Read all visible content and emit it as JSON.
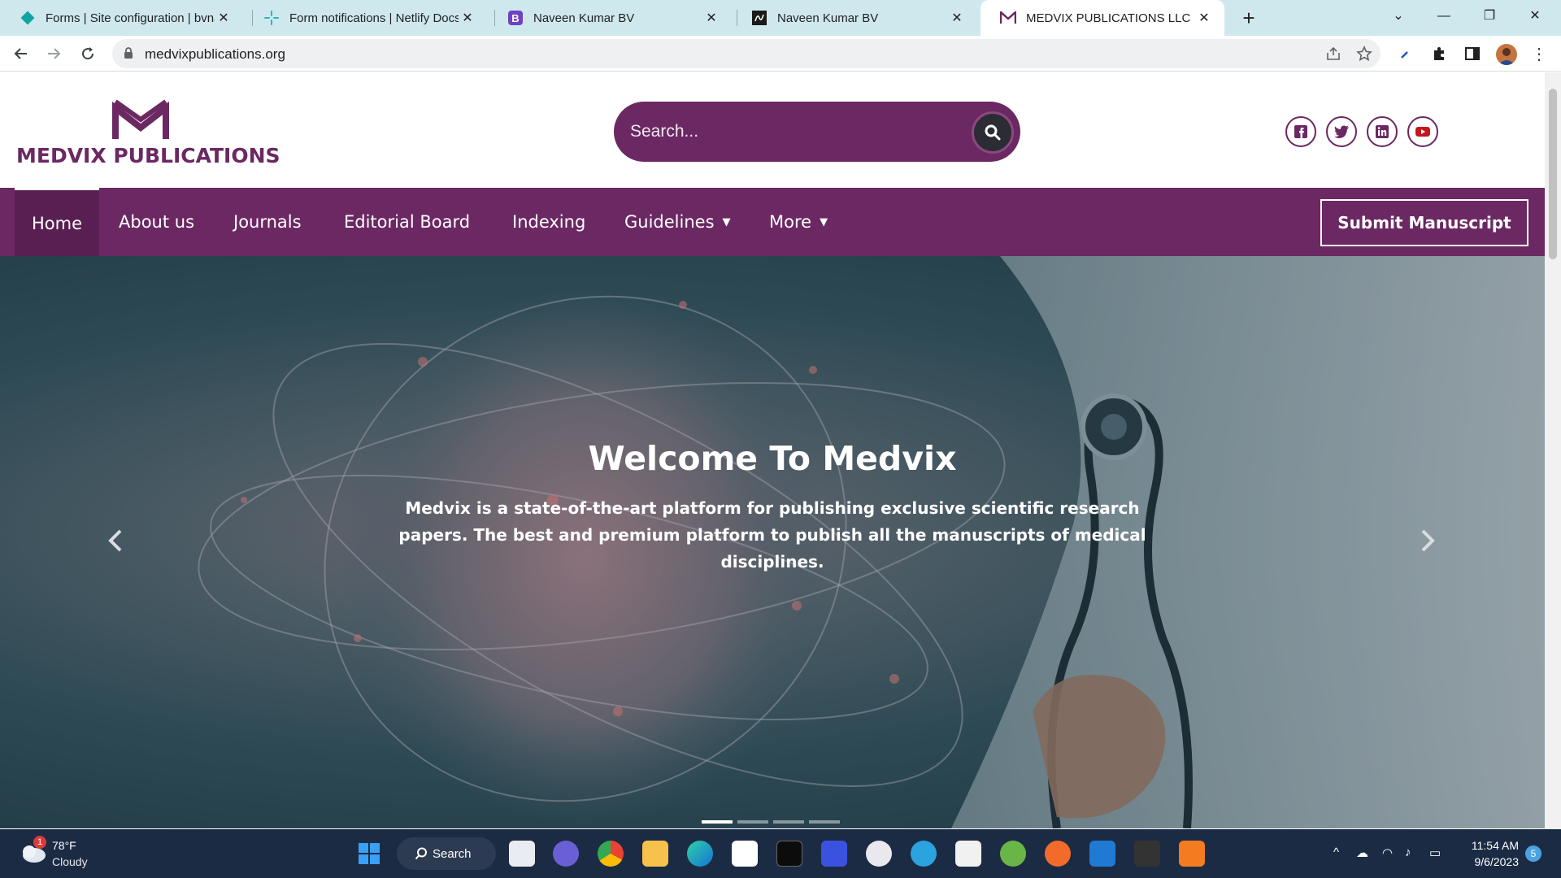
{
  "browser": {
    "tabs": [
      {
        "title": "Forms | Site configuration | bvna",
        "icon": "netlify-diamond-icon"
      },
      {
        "title": "Form notifications | Netlify Docs",
        "icon": "netlify-spark-icon"
      },
      {
        "title": "Naveen Kumar BV",
        "icon": "bootstrap-icon"
      },
      {
        "title": "Naveen Kumar BV",
        "icon": "signature-icon"
      },
      {
        "title": "MEDVIX PUBLICATIONS LLC",
        "icon": "medvix-icon"
      }
    ],
    "active_tab": 4,
    "url": "medvixpublications.org"
  },
  "site": {
    "brand": "MEDVIX PUBLICATIONS",
    "search_placeholder": "Search...",
    "nav": [
      {
        "label": "Home",
        "active": true
      },
      {
        "label": "About us"
      },
      {
        "label": "Journals"
      },
      {
        "label": "Editorial Board"
      },
      {
        "label": "Indexing"
      },
      {
        "label": "Guidelines",
        "dropdown": true
      },
      {
        "label": "More",
        "dropdown": true
      }
    ],
    "submit_label": "Submit Manuscript",
    "social": [
      "facebook-icon",
      "twitter-icon",
      "linkedin-icon",
      "youtube-icon"
    ],
    "hero": {
      "title": "Welcome To Medvix",
      "text": "Medvix is a state-of-the-art platform for publishing exclusive scientific research papers. The best and premium platform to publish all the manuscripts of medical disciplines.",
      "slides": 4,
      "active_slide": 0
    }
  },
  "taskbar": {
    "weather": {
      "temp": "78°F",
      "desc": "Cloudy",
      "badge": "1"
    },
    "search_label": "Search",
    "time": "11:54 AM",
    "date": "9/6/2023",
    "notifications": "5"
  },
  "colors": {
    "brand": "#6b2863",
    "tabstrip": "#cfe8ee",
    "taskbar": "#1c2b44"
  }
}
